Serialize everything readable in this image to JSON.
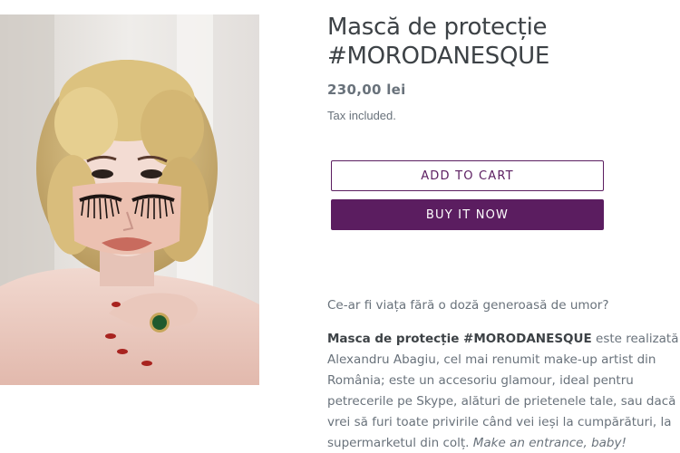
{
  "product": {
    "title_line1": "Mască de protecție",
    "title_line2": "#MORODANESQUE",
    "price": "230,00 lei",
    "tax_note": "Tax included.",
    "image_alt": "Mască de protecție #MORODANESQUE"
  },
  "actions": {
    "add_to_cart": "ADD TO CART",
    "buy_now": "BUY IT NOW"
  },
  "description": {
    "intro": "Ce-ar fi viața fără o doză generoasă de umor?",
    "bold_lead": "Masca de protecție #MORODANESQUE",
    "line1_rest": " este realizată de",
    "line2": "Alexandru Abagiu, cel mai renumit make-up artist din",
    "line3": "România; este un accesoriu glamour, ideal pentru",
    "line4": "petrecerile pe Skype, alături de prietenele tale, sau dacă",
    "line5": "vrei să furi toate privirile când vei ieși la cumpărături, la",
    "line6_start": "supermarketul din colț. ",
    "line6_italic": "Make an entrance, baby!"
  },
  "colors": {
    "brand": "#5b1d60",
    "text": "#3d4246",
    "muted": "#69727b"
  }
}
